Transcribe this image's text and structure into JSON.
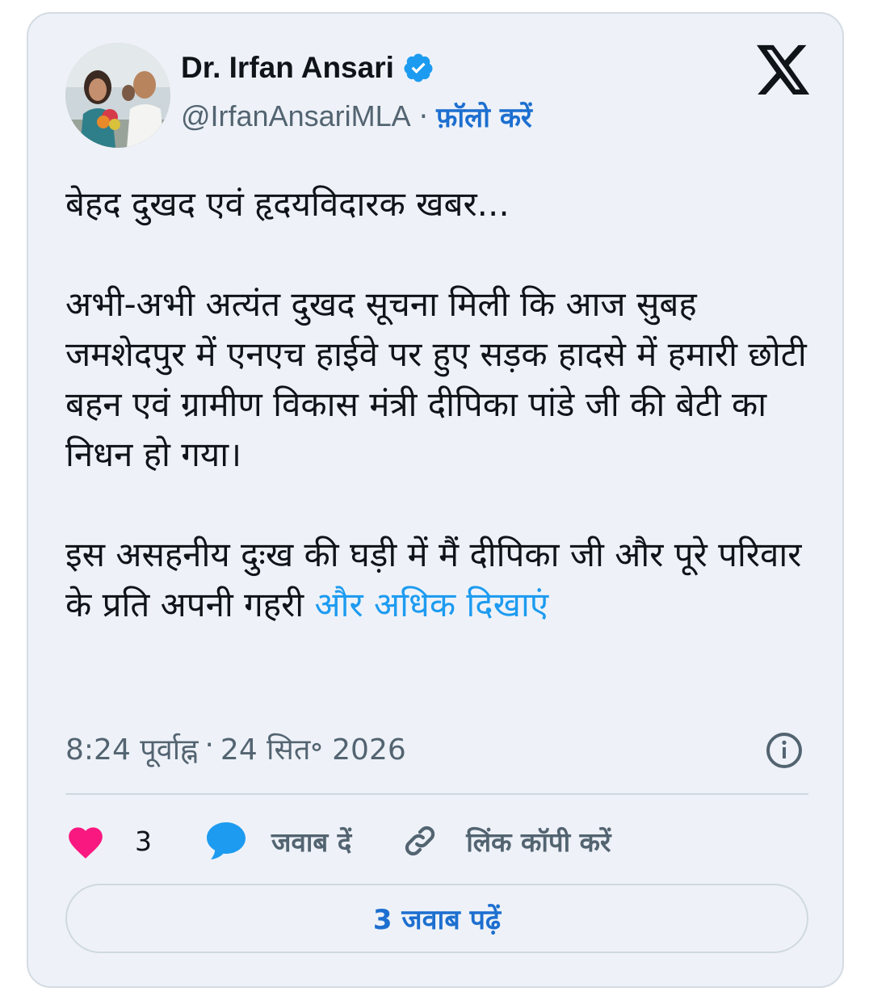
{
  "author": {
    "name": "Dr. Irfan Ansari",
    "handle": "@IrfanAnsariMLA",
    "separator": "·",
    "follow_label": "फ़ॉलो करें"
  },
  "tweet": {
    "paragraphs": [
      "बेहद दुखद एवं हृदयविदारक खबर...",
      "अभी-अभी अत्यंत दुखद सूचना मिली कि आज सुबह जमशेदपुर में एनएच हाईवे पर हुए सड़क हादसे में हमारी छोटी बहन एवं ग्रामीण विकास मंत्री दीपिका पांडे जी की बेटी का निधन हो गया।",
      "इस असहनीय दुःख की घड़ी में मैं दीपिका जी और पूरे परिवार के प्रति अपनी गहरी"
    ],
    "show_more_label": "और अधिक दिखाएं",
    "time": "8:24 पूर्वाह्न",
    "meta_separator": "·",
    "date": "24 सित॰ 2026"
  },
  "actions": {
    "like_count": "3",
    "reply_label": "जवाब दें",
    "copy_link_label": "लिंक कॉपी करें"
  },
  "read_replies_label": "3 जवाब पढ़ें",
  "icons": [
    "verified-badge-icon",
    "x-logo-icon",
    "info-icon",
    "heart-icon",
    "reply-bubble-icon",
    "link-icon"
  ],
  "colors": {
    "card_background": "#eef2f8",
    "link_blue": "#1d9bf0",
    "follow_blue": "#1d6fd0",
    "heart_pink": "#f91880",
    "muted_gray": "#536471"
  }
}
